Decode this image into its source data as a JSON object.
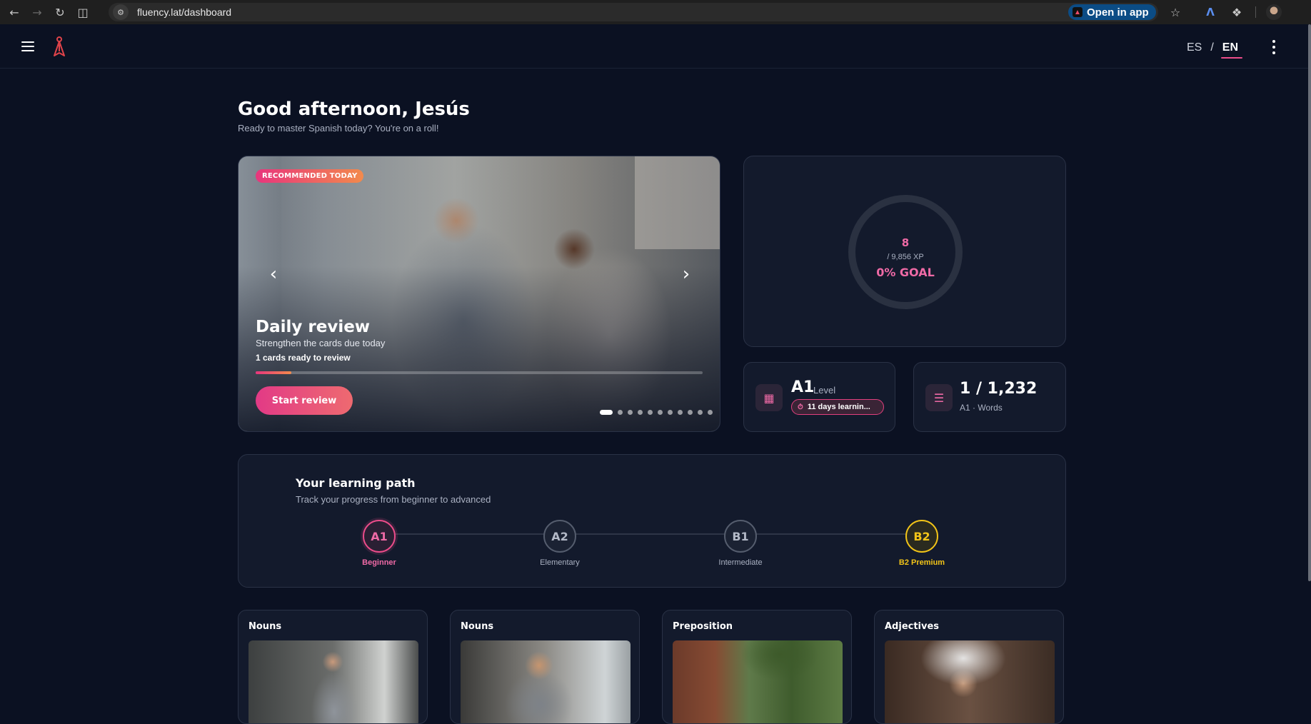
{
  "browser": {
    "url": "fluency.lat/dashboard",
    "open_in_app": "Open in app"
  },
  "header": {
    "lang_es": "ES",
    "lang_sep": "/",
    "lang_en": "EN"
  },
  "greeting": {
    "title": "Good afternoon, Jesús",
    "subtitle": "Ready to master Spanish today? You're on a roll!"
  },
  "hero": {
    "badge": "RECOMMENDED TODAY",
    "title": "Daily review",
    "subtitle": "Strengthen the cards due today",
    "count": "1 cards ready to review",
    "button": "Start review",
    "progress": 0.08,
    "slides": 11,
    "active_slide": 0
  },
  "xp": {
    "value": "8",
    "total": "/ 9,856 XP",
    "goal": "0% GOAL"
  },
  "level": {
    "value": "A1",
    "label": "Level",
    "days": "11 days learnin..."
  },
  "words": {
    "value": "1 / 1,232",
    "label": "A1 · Words"
  },
  "path": {
    "title": "Your learning path",
    "subtitle": "Track your progress from beginner to advanced",
    "nodes": [
      {
        "code": "A1",
        "label": "Beginner"
      },
      {
        "code": "A2",
        "label": "Elementary"
      },
      {
        "code": "B1",
        "label": "Intermediate"
      },
      {
        "code": "B2",
        "label": "B2 Premium"
      }
    ]
  },
  "categories": [
    {
      "title": "Nouns"
    },
    {
      "title": "Nouns"
    },
    {
      "title": "Preposition"
    },
    {
      "title": "Adjectives"
    }
  ],
  "colors": {
    "background": "#0b1122",
    "accent_pink": "#ec4c8a",
    "accent_gold": "#f2c418"
  }
}
